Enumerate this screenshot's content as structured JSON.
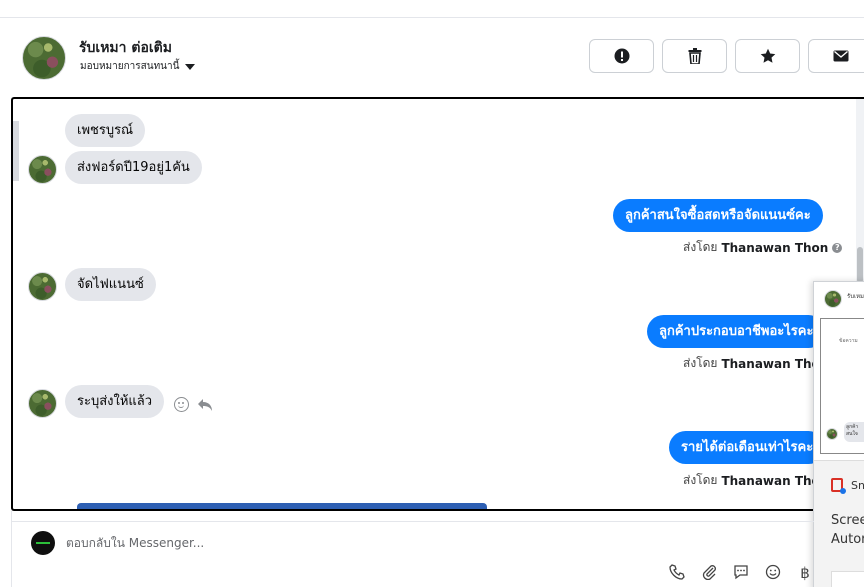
{
  "contact": {
    "name": "รับเหมา ต่อเติม",
    "assign_label": "มอบหมายการสนทนานี้"
  },
  "actions": [
    {
      "name": "spam-button",
      "glyph": "⓿"
    },
    {
      "name": "delete-button",
      "glyph": "🗑"
    },
    {
      "name": "star-button",
      "glyph": "★"
    },
    {
      "name": "mark-unread-button",
      "glyph": "✉"
    },
    {
      "name": "important-button",
      "glyph": "!"
    },
    {
      "name": "done-button",
      "glyph": "✓"
    }
  ],
  "messages": {
    "m1": "เพชรบูรณ์",
    "m2": "ส่งฟอร์ดปี19อยู่1คัน",
    "m3": "ลูกค้าสนใจซื้อสดหรือจัดแนนซ์คะ",
    "m4": "จัดไฟแนนซ์",
    "m5": "ลูกค้าประกอบอาชีพอะไรคะ",
    "m6": "ระบุส่งให้แล้ว",
    "m7": "รายได้ต่อเดือนเท่าไรคะ"
  },
  "sent_by": {
    "prefix": "ส่งโดย",
    "agent": "Thanawan Thon"
  },
  "composer": {
    "placeholder": "ตอบกลับใน Messenger..."
  },
  "floating_window": {
    "name": "รับเหมา",
    "line1": "ข้อความ",
    "bubble": "ลูกค้าสนใจ",
    "sn_label": "Sn",
    "text1": "Scree",
    "text2": "Autor"
  },
  "colors": {
    "outgoing": "#0a7cff",
    "incoming": "#e4e6eb",
    "danger": "#e41e3f"
  }
}
